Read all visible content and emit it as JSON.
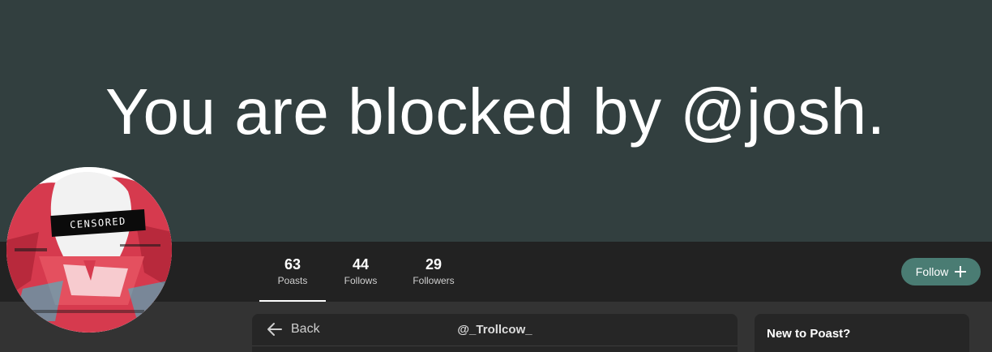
{
  "banner": {
    "text": "You are blocked by @josh.",
    "background": "#323f3f"
  },
  "avatar": {
    "censor_label": "CENSORED",
    "colors": [
      "#d63a4e",
      "#ffffff",
      "#2ec7d6",
      "#1a1a1a"
    ]
  },
  "stats": [
    {
      "value": "63",
      "label": "Poasts",
      "active": true
    },
    {
      "value": "44",
      "label": "Follows",
      "active": false
    },
    {
      "value": "29",
      "label": "Followers",
      "active": false
    }
  ],
  "follow_button": {
    "label": "Follow",
    "icon": "plus-icon",
    "color": "#4a7c73"
  },
  "main_card": {
    "back_label": "Back",
    "back_icon": "arrow-left-icon",
    "title": "@_Trollcow_"
  },
  "side_card": {
    "title": "New to Poast?"
  }
}
